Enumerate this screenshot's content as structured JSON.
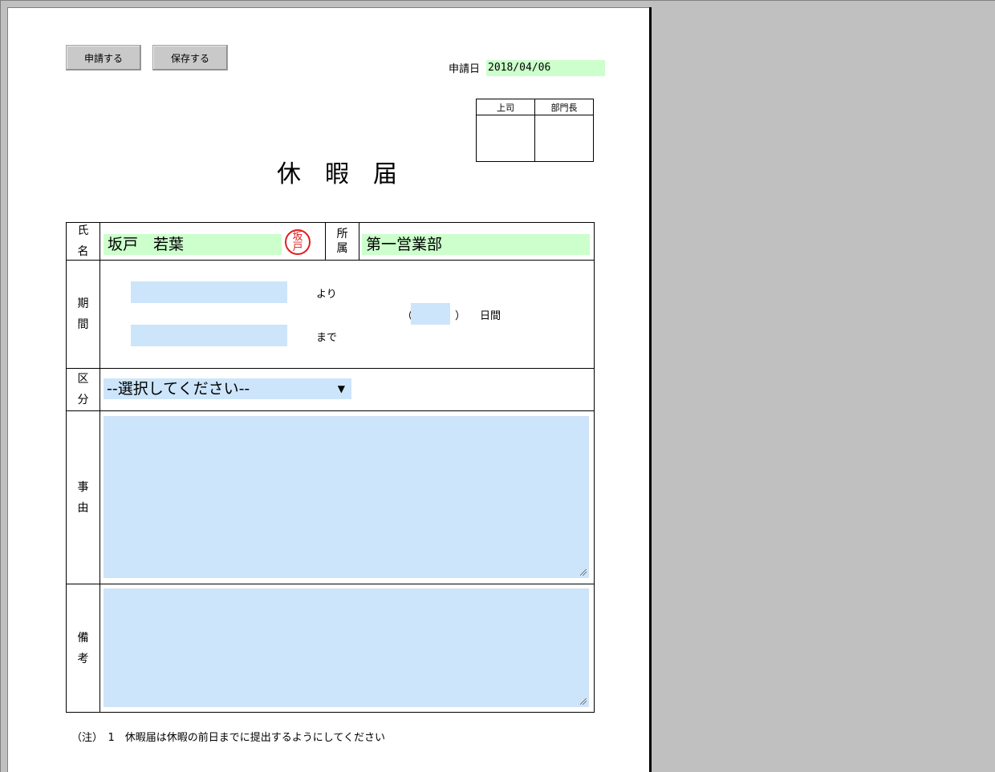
{
  "toolbar": {
    "apply_label": "申請する",
    "save_label": "保存する"
  },
  "header": {
    "apply_date_label": "申請日",
    "apply_date_value": "2018/04/06"
  },
  "approval": {
    "columns": [
      "上司",
      "部門長"
    ]
  },
  "title": "休暇届",
  "form": {
    "name": {
      "label": "氏名",
      "value": "坂戸　若葉",
      "seal_text": "坂戸"
    },
    "department": {
      "label": "所属",
      "value": "第一営業部"
    },
    "period": {
      "label": "期間",
      "from_value": "",
      "to_value": "",
      "from_suffix": "より",
      "to_suffix": "まで",
      "paren_open": "（",
      "paren_close": "）",
      "days_value": "",
      "days_suffix": "日間"
    },
    "category": {
      "label": "区分",
      "selected": "--選択してください--"
    },
    "reason": {
      "label": "事由",
      "value": ""
    },
    "remarks": {
      "label": "備考",
      "value": ""
    }
  },
  "footer_note": "（注）　1　休暇届は休暇の前日までに提出するようにしてください",
  "colors": {
    "readonly_field": "#ccffcc",
    "input_field": "#cce5fa",
    "seal": "#e02020",
    "background": "#c0c0c0"
  }
}
